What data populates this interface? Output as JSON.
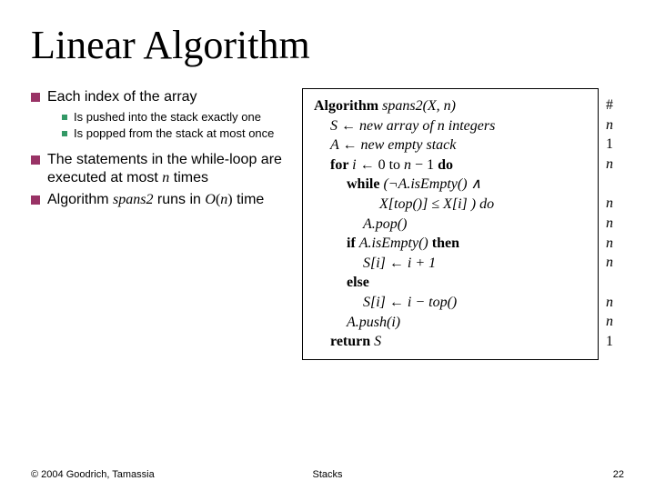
{
  "title": "Linear Algorithm",
  "bullets": {
    "b1": "Each index of the array",
    "b1_sub1": "Is pushed into the stack exactly one",
    "b1_sub2": "Is popped from the stack at most once",
    "b2_prefix": "The statements in the while-loop are executed at most ",
    "b2_n": "n",
    "b2_suffix": " times",
    "b3_prefix": "Algorithm ",
    "b3_name": "spans2",
    "b3_mid": " runs in ",
    "b3_O": "O",
    "b3_paren_open": "(",
    "b3_nvar": "n",
    "b3_paren_close": ")",
    "b3_time": " time"
  },
  "algo": {
    "l0a": "Algorithm ",
    "l0b": "spans2(X, n)",
    "l1": "S ← new array of n integers",
    "l2": "A ← new empty stack",
    "l3a": "for ",
    "l3b": "i",
    "l3c": " ← 0 to ",
    "l3d": "n",
    "l3e": " − 1 ",
    "l3f": "do",
    "l4a": "while ",
    "l4b": "(¬A.isEmpty() ∧",
    "l5": "X[top()] ≤ X[i] ) do",
    "l6": "A.pop()",
    "l7a": "if ",
    "l7b": "A.isEmpty() ",
    "l7c": "then",
    "l8": "S[i] ← i + 1",
    "l9": "else",
    "l10": "S[i] ← i − top()",
    "l11": "A.push(i)",
    "l12a": "return ",
    "l12b": "S"
  },
  "complexity": [
    "#",
    "n",
    "1",
    "n",
    "",
    "n",
    "n",
    "n",
    "n",
    "",
    "n",
    "n",
    "1"
  ],
  "footer": {
    "left": "© 2004 Goodrich, Tamassia",
    "center": "Stacks",
    "right": "22"
  }
}
